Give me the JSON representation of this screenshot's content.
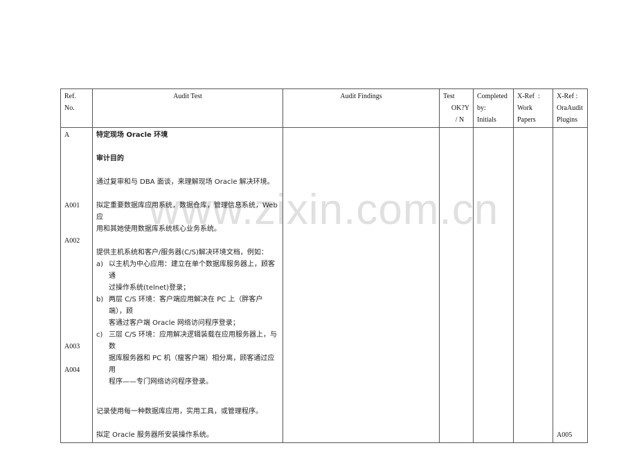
{
  "watermark": "www.zixin.com.cn",
  "table": {
    "headers": {
      "ref": [
        "Ref.",
        "No."
      ],
      "audit_test": "Audit Test",
      "audit_findings": "Audit Findings",
      "test_ok": [
        "Test",
        "OK?Y",
        "/ N"
      ],
      "completed_by": [
        "Completed",
        "by:",
        "Initials"
      ],
      "xref_work": [
        "X-Ref  :",
        "Work",
        "Papers"
      ],
      "xref_plugins": [
        "X-Ref :",
        "OraAudit",
        "Plugins"
      ]
    },
    "section": {
      "ref": "A",
      "title": "特定现场 Oracle 环境",
      "objective_heading": "审计目的",
      "objective_text": "通过复审和与 DBA 面谈，来理解现场 Oracle 解决环境。"
    },
    "rows": [
      {
        "ref": "A001",
        "lines": [
          "拟定重要数据库应用系统，数据仓库，管理信息系统，Web 应",
          "用和其她使用数据库系统核心业务系统。"
        ]
      },
      {
        "ref": "A002",
        "intro": "提供主机系统和客户/服务器(C/S)解决环境文档，例如：",
        "items": [
          {
            "mark": "a)",
            "lines": [
              "以主机为中心应用：建立在单个数据库服务器上，顾客通",
              "过操作系统(telnet)登录；"
            ]
          },
          {
            "mark": "b)",
            "lines": [
              "两层 C/S 环境：客户端应用解决在 PC 上（胖客户端），顾",
              "客通过客户端 Oracle 网络访问程序登录；"
            ]
          },
          {
            "mark": "c)",
            "lines": [
              "三层 C/S 环境：应用解决逻辑装载在应用服务器上，与数",
              "据库服务器和 PC 机（瘦客户端）相分离，顾客通过应用",
              "程序——专门网络访问程序登录。"
            ]
          }
        ]
      },
      {
        "ref": "A003",
        "lines": [
          "记录使用每一种数据库应用，实用工具，或管理程序。"
        ]
      },
      {
        "ref": "A004",
        "lines": [
          "拟定 Oracle 服务器所安装操作系统。"
        ],
        "xref_plugins": "A005"
      }
    ]
  }
}
